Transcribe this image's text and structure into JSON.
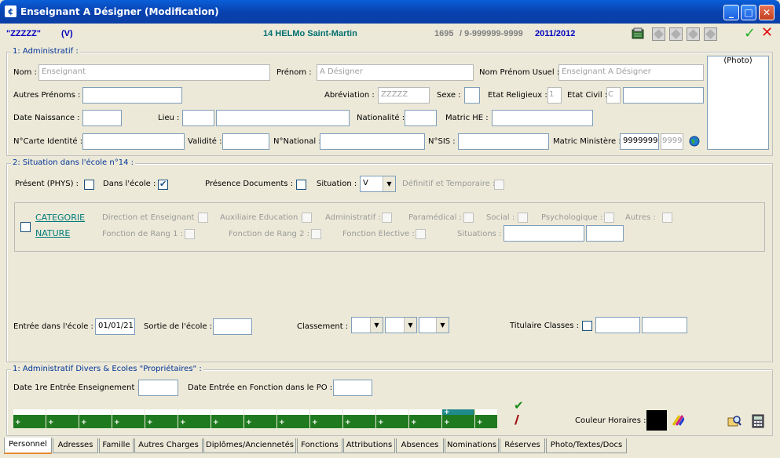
{
  "window": {
    "title": "Enseignant A Désigner (Modification)",
    "icon": "app-icon"
  },
  "header": {
    "code": "\"ZZZZZ\"",
    "flag": "(V)",
    "school": "14 HELMo Saint-Martin",
    "number": "1695",
    "range": "/ 9-999999-9999",
    "year": "2011/2012",
    "confirm_icon": "checkmark-icon",
    "cancel_icon": "close-icon"
  },
  "admin": {
    "legend": "1: Administratif :",
    "nom_label": "Nom :",
    "nom_value": "Enseignant",
    "prenom_label": "Prénom :",
    "prenom_value": "A Désigner",
    "usuel_label": "Nom Prénom Usuel :",
    "usuel_value": "Enseignant A Désigner",
    "autres_label": "Autres Prénoms :",
    "abrev_label": "Abréviation :",
    "abrev_value": "ZZZZZ",
    "sexe_label": "Sexe :",
    "religieux_label": "Etat Religieux :",
    "religieux_value": "1",
    "civil_label": "Etat Civil :",
    "civil_value": "C",
    "naissance_label": "Date Naissance :",
    "lieu_label": "Lieu :",
    "nationalite_label": "Nationalité :",
    "matric_label": "Matric HE :",
    "carte_label": "N°Carte Identité :",
    "validite_label": "Validité :",
    "national_label": "N°National :",
    "sis_label": "N°SIS :",
    "ministere_label": "Matric Ministère :",
    "ministere_value": "9999999",
    "ministere_value2": "9999",
    "photo": "(Photo)"
  },
  "situation": {
    "legend": "2: Situation dans l'école n°14 :",
    "present_label": "Présent (PHYS) :",
    "ecole_label": "Dans l'école :",
    "documents_label": "Présence Documents :",
    "situation_label": "Situation :",
    "situation_value": "V",
    "definitif_label": "Définitif et Temporaire :",
    "categorie_link": "CATEGORIE",
    "nature_link": "NATURE",
    "direction_label": "Direction et Enseignant :",
    "auxiliaire_label": "Auxiliaire Education :",
    "administratif_label": "Administratif :",
    "paramedical_label": "Paramédical :",
    "social_label": "Social :",
    "psycho_label": "Psychologique :",
    "autres_label": "Autres :",
    "rang1_label": "Fonction de Rang 1 :",
    "rang2_label": "Fonction de Rang 2 :",
    "elective_label": "Fonction Elective :",
    "situations_label": "Situations :",
    "entree_label": "Entrée dans l'école :",
    "entree_value": "01/01/21",
    "sortie_label": "Sortie de l'école :",
    "classement_label": "Classement :",
    "titulaire_label": "Titulaire Classes :"
  },
  "divers": {
    "legend": "1: Administratif Divers & Ecoles \"Propriétaires\" :",
    "date1_label": "Date 1re Entrée Enseignement :",
    "datefn_label": "Date Entrée en Fonction dans le PO :",
    "couleur_label": "Couleur Horaires :",
    "color_value": "#000000",
    "plus": "+"
  },
  "tabs": [
    "Personnel",
    "Adresses",
    "Famille",
    "Autres Charges",
    "Diplômes/Anciennetés",
    "Fonctions",
    "Attributions",
    "Absences",
    "Nominations",
    "Réserves",
    "Photo/Textes/Docs"
  ]
}
